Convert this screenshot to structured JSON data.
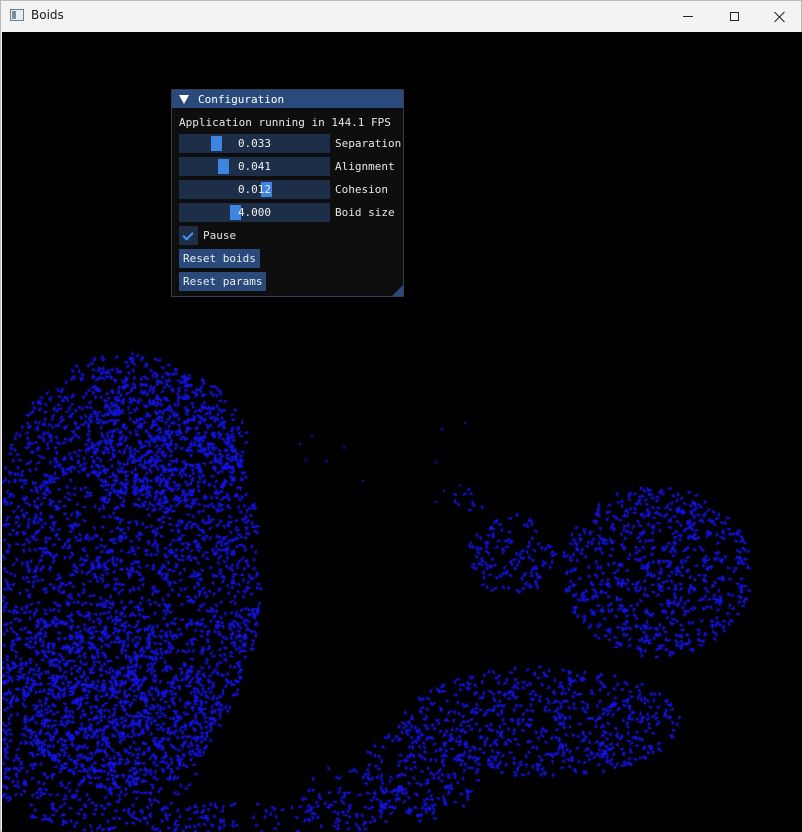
{
  "window": {
    "title": "Boids",
    "icon": "app-window-icon",
    "controls": [
      "minimize-icon",
      "maximize-icon",
      "close-icon"
    ]
  },
  "scene": {
    "background_color": "#000000",
    "boid_color": "#1414e6"
  },
  "config_panel": {
    "title": "Configuration",
    "fps_text": "Application running in 144.1 FPS",
    "accent_color": "#3d85e0",
    "sliders": [
      {
        "value": "0.033",
        "label": "Separation",
        "fill": 0.22
      },
      {
        "value": "0.041",
        "label": "Alignment",
        "fill": 0.27
      },
      {
        "value": "0.012",
        "label": "Cohesion",
        "fill": 0.59
      },
      {
        "value": "4.000",
        "label": "Boid size",
        "fill": 0.36
      }
    ],
    "pause": {
      "label": "Pause",
      "checked": true
    },
    "buttons": {
      "reset_boids": "Reset boids",
      "reset_params": "Reset params"
    }
  }
}
